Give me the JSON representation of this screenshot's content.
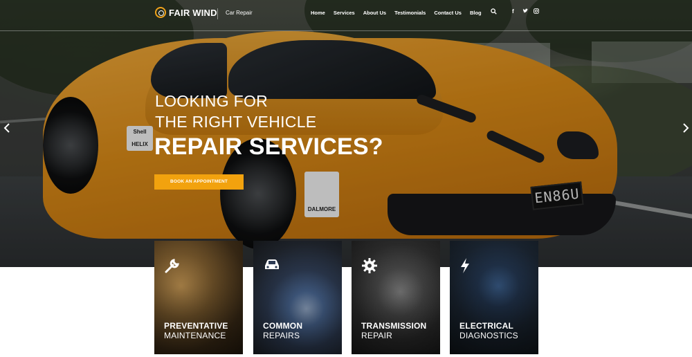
{
  "brand": {
    "name": "FAIR WIND",
    "tagline": "Car Repair",
    "accent": "#f2a20e"
  },
  "nav": {
    "items": [
      "Home",
      "Services",
      "About Us",
      "Testimonials",
      "Contact Us",
      "Blog"
    ],
    "search_icon": "search-icon",
    "social_icons": [
      "facebook-icon",
      "twitter-icon",
      "instagram-icon"
    ]
  },
  "hero": {
    "line1": "LOOKING FOR",
    "line2": "THE RIGHT VEHICLE",
    "line3": "REPAIR SERVICES?",
    "cta": "BOOK AN APPOINTMENT",
    "prev_icon": "chevron-left-icon",
    "next_icon": "chevron-right-icon",
    "plate": "EN86U",
    "sticker1": "Shell HELIX",
    "sticker2": "DALMORE"
  },
  "services": [
    {
      "title": "PREVENTATIVE",
      "subtitle": "MAINTENANCE",
      "icon": "wrench-icon"
    },
    {
      "title": "COMMON",
      "subtitle": "REPAIRS",
      "icon": "car-icon"
    },
    {
      "title": "TRANSMISSION",
      "subtitle": "REPAIR",
      "icon": "gear-icon"
    },
    {
      "title": "ELECTRICAL",
      "subtitle": "DIAGNOSTICS",
      "icon": "lightning-icon"
    }
  ]
}
